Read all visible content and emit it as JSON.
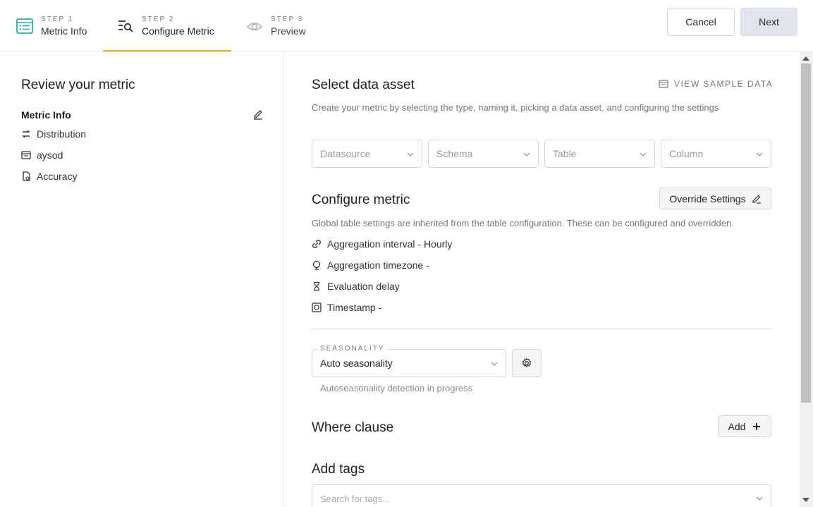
{
  "steps": [
    {
      "label": "STEP 1",
      "name": "Metric Info"
    },
    {
      "label": "STEP 2",
      "name": "Configure Metric"
    },
    {
      "label": "STEP 3",
      "name": "Preview"
    }
  ],
  "actions": {
    "cancel": "Cancel",
    "next": "Next"
  },
  "left": {
    "title": "Review your metric",
    "section": "Metric Info",
    "items": [
      {
        "icon": "distribution-icon",
        "label": "Distribution"
      },
      {
        "icon": "table-icon",
        "label": "aysod"
      },
      {
        "icon": "accuracy-icon",
        "label": "Accuracy"
      }
    ]
  },
  "data_asset": {
    "title": "Select data asset",
    "view_sample": "VIEW SAMPLE DATA",
    "subtitle": "Create your metric by selecting the type, naming it, picking a data asset, and configuring the settings",
    "selects": [
      {
        "placeholder": "Datasource"
      },
      {
        "placeholder": "Schema"
      },
      {
        "placeholder": "Table"
      },
      {
        "placeholder": "Column"
      }
    ]
  },
  "configure": {
    "title": "Configure metric",
    "override": "Override Settings",
    "subtitle": "Global table settings are inherited from the table configuration. These can be configured and overridden.",
    "settings": [
      {
        "icon": "link-icon",
        "label": "Aggregation interval - Hourly"
      },
      {
        "icon": "globe-icon",
        "label": "Aggregation timezone -"
      },
      {
        "icon": "hourglass-icon",
        "label": "Evaluation delay"
      },
      {
        "icon": "clock-icon",
        "label": "Timestamp -"
      }
    ]
  },
  "seasonality": {
    "legend": "SEASONALITY",
    "value": "Auto seasonality",
    "hint": "Autoseasonality detection in progress"
  },
  "where": {
    "title": "Where clause",
    "add": "Add"
  },
  "tags": {
    "title": "Add tags",
    "placeholder": "Search for tags..."
  },
  "colors": {
    "accent": "#f2a93b",
    "step1_icon": "#2fae9a"
  }
}
